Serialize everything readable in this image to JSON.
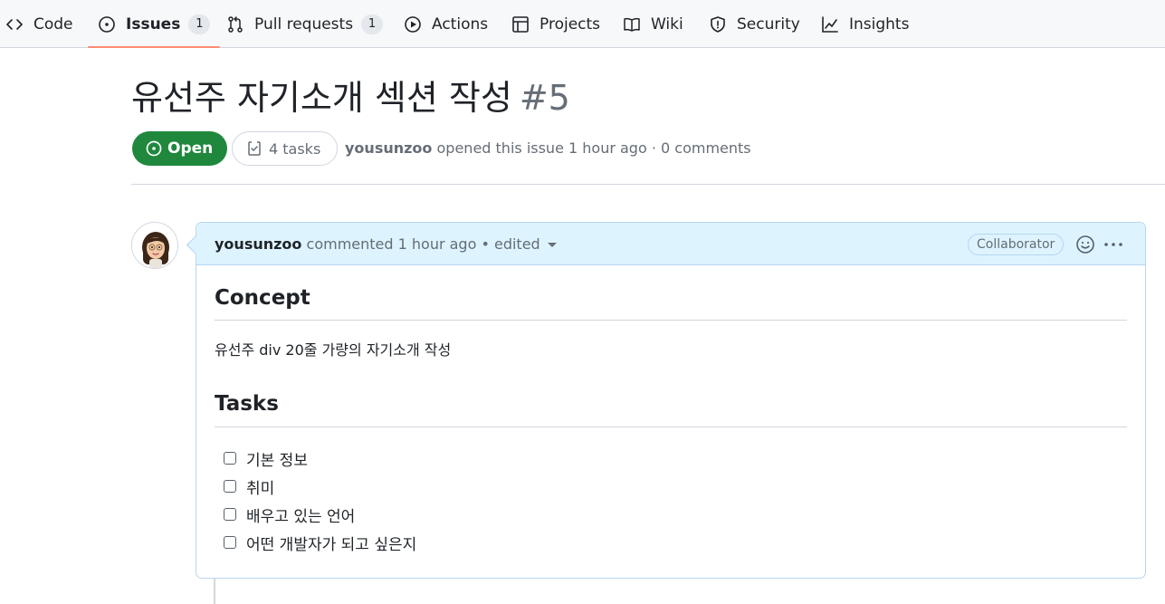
{
  "nav": {
    "items": [
      {
        "label": "Code",
        "icon": "code-icon"
      },
      {
        "label": "Issues",
        "icon": "issue-opened-icon",
        "count": "1",
        "selected": true
      },
      {
        "label": "Pull requests",
        "icon": "git-pull-request-icon",
        "count": "1"
      },
      {
        "label": "Actions",
        "icon": "play-icon"
      },
      {
        "label": "Projects",
        "icon": "table-icon"
      },
      {
        "label": "Wiki",
        "icon": "book-icon"
      },
      {
        "label": "Security",
        "icon": "shield-icon"
      },
      {
        "label": "Insights",
        "icon": "graph-icon"
      }
    ]
  },
  "issue": {
    "title": "유선주 자기소개 섹션 작성",
    "number": "#5",
    "state": "Open",
    "tasks_label": "4 tasks",
    "author": "yousunzoo",
    "meta_text": "opened this issue 1 hour ago · 0 comments"
  },
  "comment": {
    "author": "yousunzoo",
    "meta_text": "commented 1 hour ago • edited",
    "role": "Collaborator",
    "body": {
      "heading1": "Concept",
      "paragraph": "유선주 div 20줄 가량의 자기소개 작성",
      "heading2": "Tasks",
      "tasks": [
        {
          "label": "기본 정보",
          "checked": false
        },
        {
          "label": "취미",
          "checked": false
        },
        {
          "label": "배우고 있는 언어",
          "checked": false
        },
        {
          "label": "어떤 개발자가 되고 싶은지",
          "checked": false
        }
      ]
    }
  },
  "colors": {
    "open_green": "#1f883d",
    "selected_underline": "#fd8c73",
    "comment_header_bg": "#ddf4ff",
    "comment_border": "#b6d6f2"
  }
}
